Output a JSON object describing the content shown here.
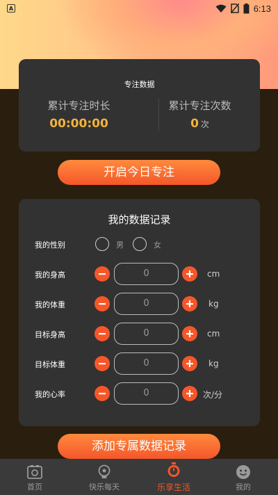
{
  "status_bar": {
    "time": "6:13",
    "notification_letter": "A"
  },
  "focus": {
    "title": "专注数据",
    "total_time_label": "累计专注时长",
    "total_time_value": "00:00:00",
    "total_count_label": "累计专注次数",
    "total_count_value": "0",
    "total_count_unit": "次"
  },
  "start_button": "开启今日专注",
  "records": {
    "title": "我的数据记录",
    "gender": {
      "label": "我的性别",
      "options": [
        "男",
        "女"
      ]
    },
    "rows": [
      {
        "label": "我的身高",
        "value": "0",
        "unit": "cm"
      },
      {
        "label": "我的体重",
        "value": "0",
        "unit": "kg"
      },
      {
        "label": "目标身高",
        "value": "0",
        "unit": "cm"
      },
      {
        "label": "目标体重",
        "value": "0",
        "unit": "kg"
      },
      {
        "label": "我的心率",
        "value": "0",
        "unit": "次/分"
      }
    ]
  },
  "add_button": "添加专属数据记录",
  "nav": {
    "items": [
      {
        "label": "首页",
        "icon": "photo-icon"
      },
      {
        "label": "快乐每天",
        "icon": "bulb-icon"
      },
      {
        "label": "乐享生活",
        "icon": "timer-icon",
        "active": true
      },
      {
        "label": "我的",
        "icon": "smiley-icon"
      }
    ]
  },
  "colors": {
    "accent": "#f5562a",
    "highlight": "#f4b23e",
    "card": "#323232",
    "background": "#2a1f0f"
  }
}
